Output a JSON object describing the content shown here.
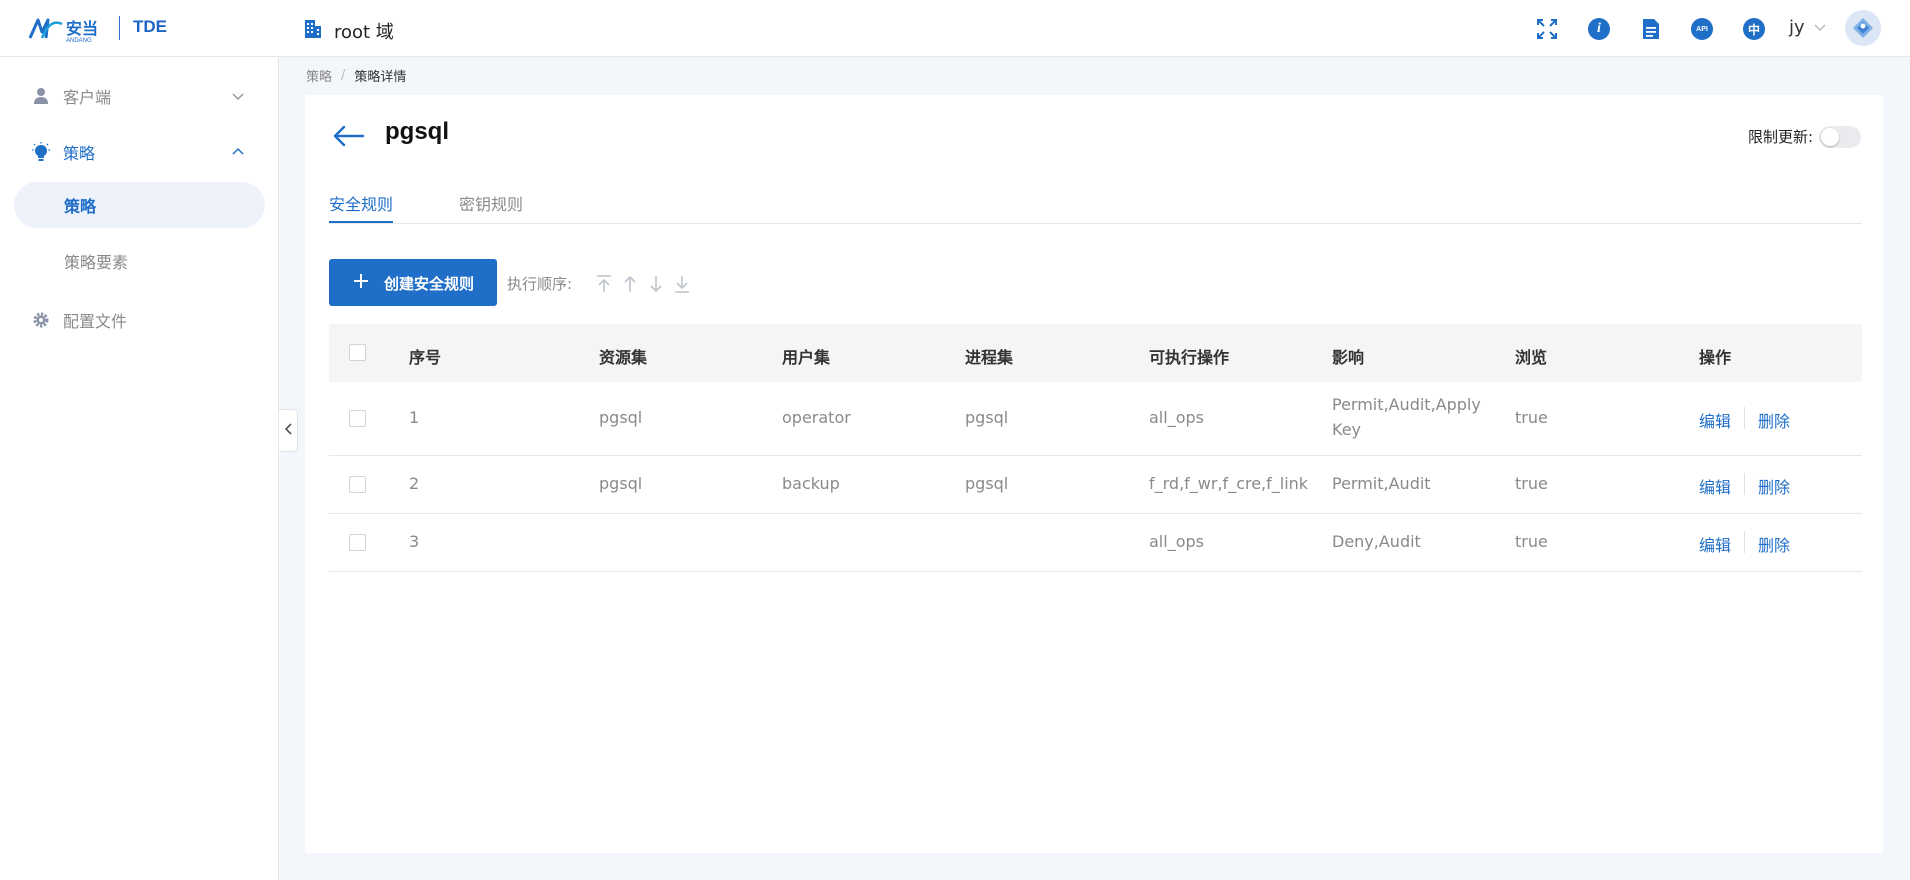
{
  "header": {
    "logo_text": "安当 ANDANG",
    "product": "TDE",
    "domain": "root 域",
    "icons": [
      "fullscreen-icon",
      "info-icon",
      "document-icon",
      "api-icon",
      "language-icon"
    ],
    "api_badge": "API",
    "lang_badge": "中",
    "user": "jy"
  },
  "sidebar": {
    "items": [
      {
        "label": "客户端",
        "icon": "user-icon"
      },
      {
        "label": "策略",
        "icon": "lightbulb-icon"
      },
      {
        "label": "策略",
        "sub": true
      },
      {
        "label": "策略要素",
        "sub": true
      },
      {
        "label": "配置文件",
        "icon": "gear-icon"
      }
    ]
  },
  "breadcrumb": {
    "parent": "策略",
    "sep": "/",
    "current": "策略详情"
  },
  "page": {
    "title": "pgsql",
    "limit_update_label": "限制更新:",
    "limit_update_on": false
  },
  "tabs": [
    {
      "label": "安全规则",
      "active": true
    },
    {
      "label": "密钥规则",
      "active": false
    }
  ],
  "toolbar": {
    "create_label": "创建安全规则",
    "order_label": "执行顺序:"
  },
  "table": {
    "columns": [
      "序号",
      "资源集",
      "用户集",
      "进程集",
      "可执行操作",
      "影响",
      "浏览",
      "操作"
    ],
    "rows": [
      {
        "index": "1",
        "resource": "pgsql",
        "user": "operator",
        "process": "pgsql",
        "ops": "all_ops",
        "effect_line1": "Permit,Audit,Apply",
        "effect_line2": "Key",
        "browse": "true",
        "edit": "编辑",
        "delete": "删除"
      },
      {
        "index": "2",
        "resource": "pgsql",
        "user": "backup",
        "process": "pgsql",
        "ops": "f_rd,f_wr,f_cre,f_link",
        "effect_line1": "Permit,Audit",
        "effect_line2": "",
        "browse": "true",
        "edit": "编辑",
        "delete": "删除"
      },
      {
        "index": "3",
        "resource": "",
        "user": "",
        "process": "",
        "ops": "all_ops",
        "effect_line1": "Deny,Audit",
        "effect_line2": "",
        "browse": "true",
        "edit": "编辑",
        "delete": "删除"
      }
    ]
  },
  "colors": {
    "accent": "#1f6ec8",
    "page_bg": "#f3f6fb",
    "muted_text": "#8a8a8a"
  }
}
